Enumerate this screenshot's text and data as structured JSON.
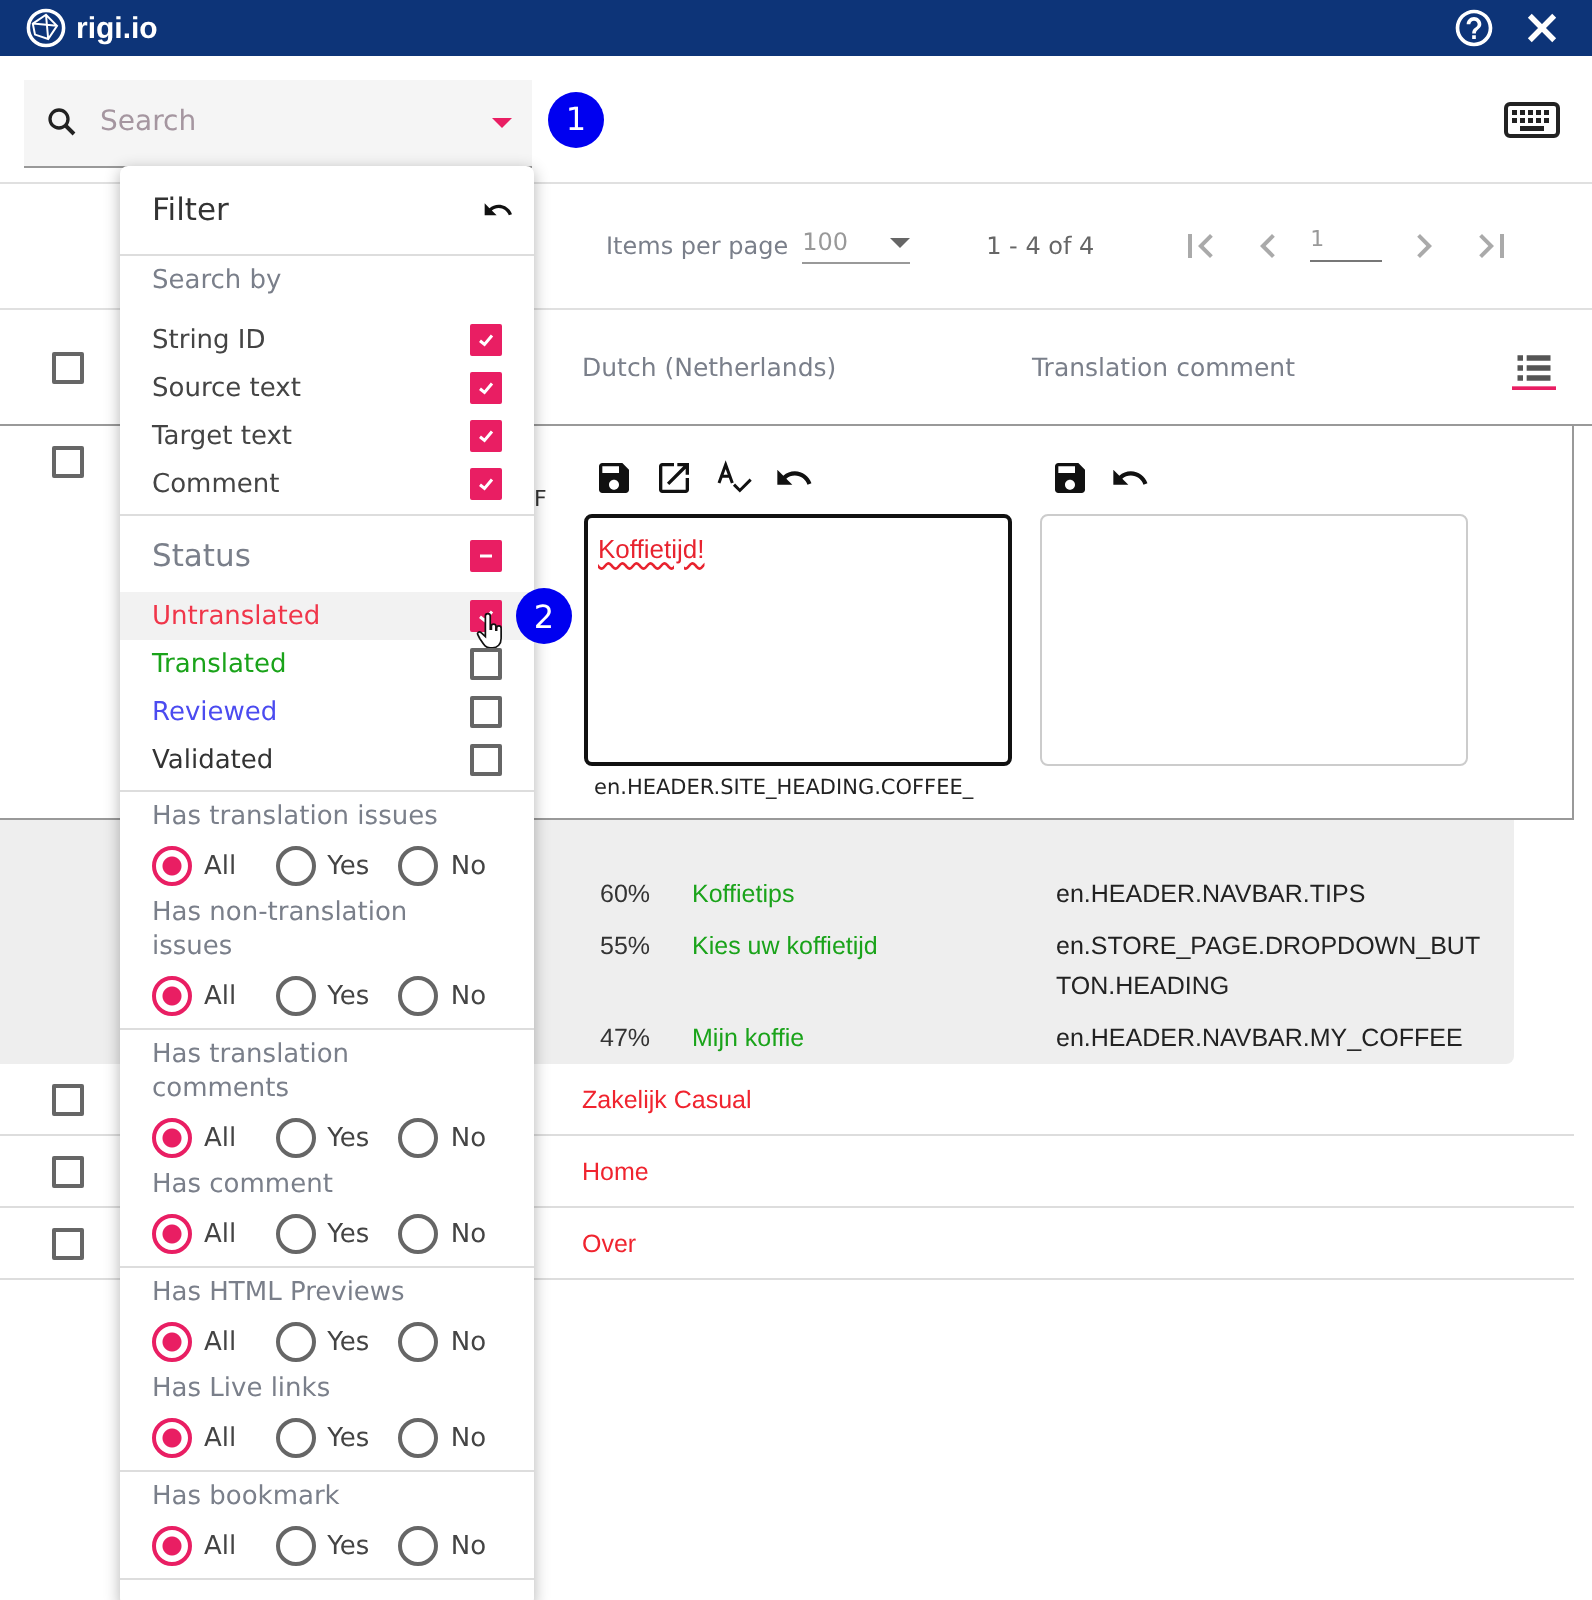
{
  "header": {
    "logo": "rigi.io"
  },
  "search": {
    "placeholder": "Search",
    "step": "1"
  },
  "pagination": {
    "items_label": "Items per page",
    "page_size": "100",
    "range": "1 - 4 of 4",
    "page": "1"
  },
  "table": {
    "header_checked": false,
    "columns": [
      {
        "label": "Dutch (Netherlands)"
      },
      {
        "label": "Translation comment"
      }
    ],
    "expanded_row": {
      "checked": false,
      "fragment": "F",
      "translation": "Koffietijd!",
      "string_id": "en.HEADER.SITE_HEADING.COFFEE_"
    },
    "suggestions": [
      {
        "match": "60%",
        "text": "Koffietips",
        "string_id": "en.HEADER.NAVBAR.TIPS"
      },
      {
        "match": "55%",
        "text": "Kies uw koffietijd",
        "string_id": "en.STORE_PAGE.DROPDOWN_BUTTON.HEADING"
      },
      {
        "match": "47%",
        "text": "Mijn koffie",
        "string_id": "en.HEADER.NAVBAR.MY_COFFEE"
      }
    ],
    "rows": [
      {
        "text": "Zakelijk Casual",
        "checked": false
      },
      {
        "text": "Home",
        "checked": false
      },
      {
        "text": "Over",
        "checked": false
      }
    ]
  },
  "filter": {
    "title": "Filter",
    "search_by": {
      "label": "Search by",
      "options": [
        {
          "label": "String ID",
          "checked": true
        },
        {
          "label": "Source text",
          "checked": true
        },
        {
          "label": "Target text",
          "checked": true
        },
        {
          "label": "Comment",
          "checked": true
        }
      ]
    },
    "status": {
      "label": "Status",
      "partially_checked": true,
      "step": "2",
      "options": [
        {
          "label": "Untranslated",
          "checked": true,
          "hovered": true,
          "color": "#f0364a"
        },
        {
          "label": "Translated",
          "checked": false,
          "hovered": false,
          "color": "#1aa31a"
        },
        {
          "label": "Reviewed",
          "checked": false,
          "hovered": false,
          "color": "#4b4bf0"
        },
        {
          "label": "Validated",
          "checked": false,
          "hovered": false,
          "color": "#333333"
        }
      ]
    },
    "sections": [
      {
        "groups": [
          {
            "label": "Has translation issues",
            "options": [
              {
                "label": "All",
                "selected": true
              },
              {
                "label": "Yes",
                "selected": false
              },
              {
                "label": "No",
                "selected": false
              }
            ]
          },
          {
            "label": "Has non-translation issues",
            "options": [
              {
                "label": "All",
                "selected": true
              },
              {
                "label": "Yes",
                "selected": false
              },
              {
                "label": "No",
                "selected": false
              }
            ]
          }
        ]
      },
      {
        "groups": [
          {
            "label": "Has translation comments",
            "options": [
              {
                "label": "All",
                "selected": true
              },
              {
                "label": "Yes",
                "selected": false
              },
              {
                "label": "No",
                "selected": false
              }
            ]
          },
          {
            "label": "Has comment",
            "options": [
              {
                "label": "All",
                "selected": true
              },
              {
                "label": "Yes",
                "selected": false
              },
              {
                "label": "No",
                "selected": false
              }
            ]
          }
        ]
      },
      {
        "groups": [
          {
            "label": "Has HTML Previews",
            "options": [
              {
                "label": "All",
                "selected": true
              },
              {
                "label": "Yes",
                "selected": false
              },
              {
                "label": "No",
                "selected": false
              }
            ]
          },
          {
            "label": "Has Live links",
            "options": [
              {
                "label": "All",
                "selected": true
              },
              {
                "label": "Yes",
                "selected": false
              },
              {
                "label": "No",
                "selected": false
              }
            ]
          }
        ]
      },
      {
        "groups": [
          {
            "label": "Has bookmark",
            "options": [
              {
                "label": "All",
                "selected": true
              },
              {
                "label": "Yes",
                "selected": false
              },
              {
                "label": "No",
                "selected": false
              }
            ]
          }
        ]
      }
    ]
  }
}
